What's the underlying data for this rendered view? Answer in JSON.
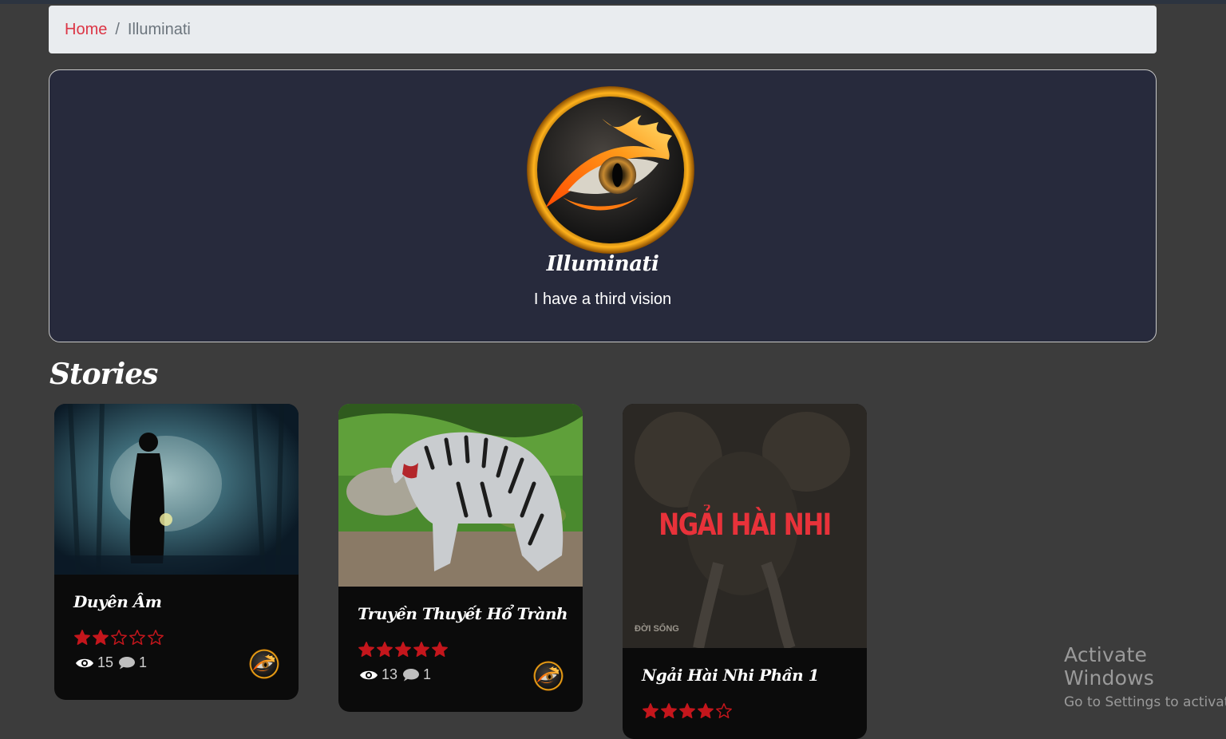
{
  "breadcrumb": {
    "home": "Home",
    "separator": "/",
    "current": "Illuminati"
  },
  "profile": {
    "name": "Illuminati",
    "bio": "I have a third vision",
    "avatar_icon": "flaming-eye-icon"
  },
  "section": {
    "title": "Stories"
  },
  "stories": [
    {
      "title": "Duyên Âm",
      "rating": 2,
      "views": "15",
      "comments": "1"
    },
    {
      "title": "Truyền Thuyết Hổ Trành",
      "rating": 5,
      "views": "13",
      "comments": "1"
    },
    {
      "title": "Ngải Hài Nhi Phần 1",
      "rating": 4,
      "cover_text": "NGẢI HÀI NHI",
      "cover_brand": "ĐỜI SỐNG"
    }
  ],
  "watermark": {
    "title": "Activate Windows",
    "subtitle": "Go to Settings to activate"
  },
  "colors": {
    "accent_red": "#dc3545",
    "star_red": "#c4161c",
    "card_bg": "#0b0b0b",
    "profile_bg": "#272a3c"
  }
}
